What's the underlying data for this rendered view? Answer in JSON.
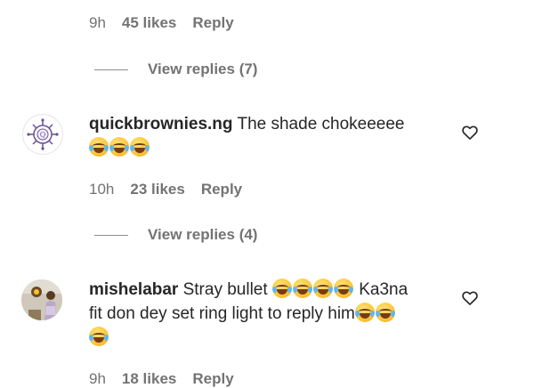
{
  "thread": [
    {
      "meta": {
        "time": "9h",
        "likes": "45 likes",
        "reply": "Reply"
      }
    },
    {
      "view_replies": "View replies (7)"
    },
    {
      "username": "quickbrownies.ng",
      "text": "The shade chokeeeee",
      "emoji_name": "face-with-tears-of-joy",
      "meta": {
        "time": "10h",
        "likes": "23 likes",
        "reply": "Reply"
      },
      "view_replies": "View replies (4)"
    },
    {
      "username": "mishelabar",
      "text_part1": "Stray bullet",
      "text_part2": "Ka3na",
      "text_line2": "fit don dey set ring light to reply him",
      "emoji_name": "face-with-tears-of-joy",
      "meta": {
        "time": "9h",
        "likes": "18 likes",
        "reply": "Reply"
      }
    }
  ],
  "icons": {
    "like": "heart-outline-icon"
  },
  "colors": {
    "text": "#262626",
    "secondary": "#737373",
    "background": "#ffffff"
  }
}
